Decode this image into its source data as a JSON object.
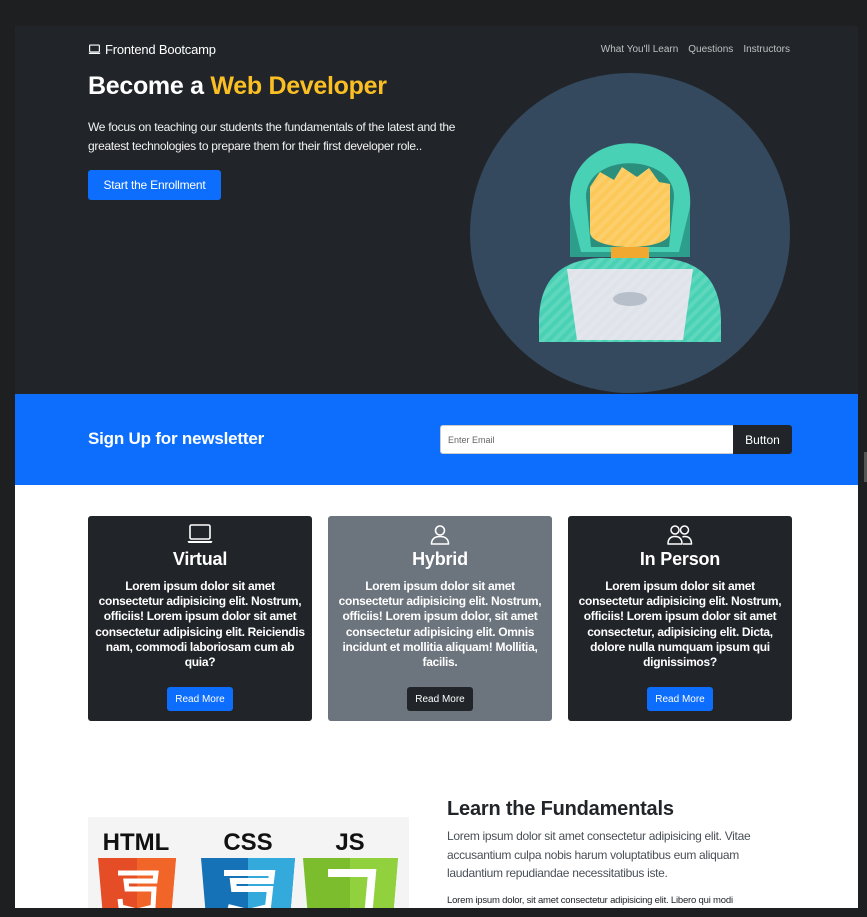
{
  "brand": {
    "label": "Frontend Bootcamp",
    "icon": "laptop-icon"
  },
  "nav": {
    "items": [
      "What You'll Learn",
      "Questions",
      "Instructors"
    ]
  },
  "hero": {
    "title_prefix": "Become a",
    "title_accent": "Web Developer",
    "description": "We focus on teaching our students the fundamentals of the latest and the greatest technologies to prepare them for their first developer role..",
    "cta_label": "Start the Enrollment",
    "accent_color": "#fbbf24"
  },
  "newsletter": {
    "title": "Sign Up for newsletter",
    "input_placeholder": "Enter Email",
    "button_label": "Button"
  },
  "cards": [
    {
      "icon": "laptop-icon",
      "title": "Virtual",
      "text": "Lorem ipsum dolor sit amet consectetur adipisicing elit. Nostrum, officiis! Lorem ipsum dolor sit amet consectetur adipisicing elit. Reiciendis nam, commodi laboriosam cum ab quia?",
      "button_label": "Read More"
    },
    {
      "icon": "person-icon",
      "title": "Hybrid",
      "text": "Lorem ipsum dolor sit amet consectetur adipisicing elit. Nostrum, officiis! Lorem ipsum dolor, sit amet consectetur adipisicing elit. Omnis incidunt et mollitia aliquam! Mollitia, facilis.",
      "button_label": "Read More"
    },
    {
      "icon": "people-icon",
      "title": "In Person",
      "text": "Lorem ipsum dolor sit amet consectetur adipisicing elit. Nostrum, officiis! Lorem ipsum dolor sit amet consectetur, adipisicing elit. Dicta, dolore nulla numquam ipsum qui dignissimos?",
      "button_label": "Read More"
    }
  ],
  "learn": {
    "title": "Learn the Fundamentals",
    "lead": "Lorem ipsum dolor sit amet consectetur adipisicing elit. Vitae accusantium culpa nobis harum voluptatibus eum aliquam laudantium repudiandae necessitatibus iste.",
    "text": "Lorem ipsum dolor, sit amet consectetur adipisicing elit. Libero qui modi",
    "image_labels": [
      "HTML",
      "CSS",
      "JS"
    ]
  },
  "colors": {
    "primary": "#0d6efd",
    "dark": "#212529",
    "gray": "#6c757d"
  }
}
